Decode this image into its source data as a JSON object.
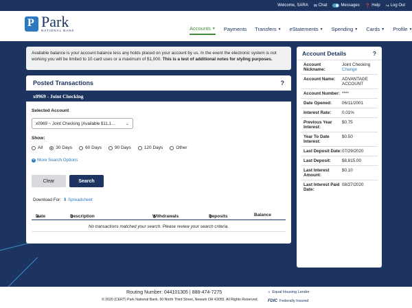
{
  "topbar": {
    "welcome": "Welcome, SARA",
    "chat": "Chat",
    "messages": "Messages",
    "help": "Help",
    "logout": "Log Out"
  },
  "brand": {
    "name": "Park",
    "sub": "NATIONAL BANK"
  },
  "nav": [
    {
      "label": "Accounts"
    },
    {
      "label": "Payments"
    },
    {
      "label": "Transfers"
    },
    {
      "label": "eStatements"
    },
    {
      "label": "Spending"
    },
    {
      "label": "Cards"
    },
    {
      "label": "Profile"
    }
  ],
  "notice": {
    "text": "Available balance is your account balance less any holds placed on your account by us. In the event the electronic system is not working you will be limited to 10 card uses or a maximum of $1,000.",
    "bold": "This is a test of additional notes for styling purposes."
  },
  "posted": {
    "title": "Posted Transactions",
    "help": "?",
    "account_band": "x0969 - Joint Checking",
    "selected_label": "Selected Account",
    "selected_value": "x0969 ~ Joint Checking (Available $11,1…",
    "show_label": "Show:",
    "radios": [
      "All",
      "30 Days",
      "60 Days",
      "90 Days",
      "120 Days",
      "Other"
    ],
    "more_options": "More Search Options",
    "clear": "Clear",
    "search": "Search",
    "download_label": "Download For:",
    "download_link": "Spreadsheet",
    "headers": {
      "date": "Date",
      "description": "Description",
      "withdrawals": "Withdrawals",
      "deposits": "Deposits",
      "balance": "Balance"
    },
    "empty": "No transactions matched your search. Please review your search criteria."
  },
  "details": {
    "title": "Account Details",
    "help": "?",
    "rows": [
      {
        "k": "Account Nickname:",
        "v": "Joint Checking",
        "link": "Change"
      },
      {
        "k": "Account Name:",
        "v": "ADVANTAGE ACCOUNT"
      },
      {
        "k": "Account Number:",
        "v": "****"
      },
      {
        "k": "Date Opened:",
        "v": "06/11/2001"
      },
      {
        "k": "Interest Rate:",
        "v": "0.01%"
      },
      {
        "k": "Previous Year Interest:",
        "v": "$0.75"
      },
      {
        "k": "Year To Date Interest:",
        "v": "$0.50"
      },
      {
        "k": "Last Deposit Date:",
        "v": "07/29/2020"
      },
      {
        "k": "Last Deposit:",
        "v": "$8,815.00"
      },
      {
        "k": "Last Interest Amount:",
        "v": "$0.10"
      },
      {
        "k": "Last Interest Paid Date:",
        "v": "08/27/2020"
      }
    ]
  },
  "footer": {
    "routing": "Routing Number: 044101305  |  888-474-7275",
    "copyright": "© 2020 (CERT) Park National Bank. 50 North Third Street, Newark OH 43055. All Rights Reserved.",
    "ehl": "Equal Housing Lender",
    "fdic_mark": "FDIC",
    "fdic_text": "Federally Insured"
  }
}
